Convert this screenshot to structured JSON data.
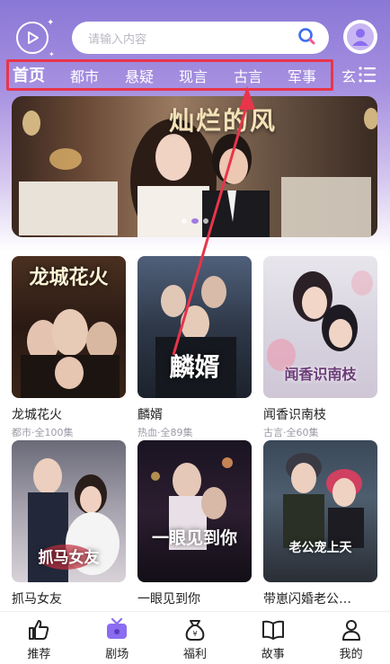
{
  "search": {
    "placeholder": "请输入内容"
  },
  "categories": [
    "首页",
    "都市",
    "悬疑",
    "现言",
    "古言",
    "军事",
    "玄幻"
  ],
  "banner": {
    "title": "灿烂的风"
  },
  "dramas": [
    {
      "name": "龙城花火",
      "meta": "都市·全100集",
      "poster_text": "龙城花火"
    },
    {
      "name": "麟婿",
      "meta": "热血·全89集",
      "poster_text": "麟婿"
    },
    {
      "name": "闻香识南枝",
      "meta": "古言·全60集",
      "poster_text": "闻香识南枝"
    },
    {
      "name": "抓马女友",
      "meta": "",
      "poster_text": "抓马女友"
    },
    {
      "name": "一眼见到你",
      "meta": "",
      "poster_text": "一眼见到你"
    },
    {
      "name": "带崽闪婚老公…",
      "meta": "",
      "poster_text": "老公宠上天"
    }
  ],
  "tabs": [
    {
      "label": "推荐",
      "icon": "thumbs-up-icon"
    },
    {
      "label": "剧场",
      "icon": "tv-icon"
    },
    {
      "label": "福利",
      "icon": "money-bag-icon"
    },
    {
      "label": "故事",
      "icon": "book-icon"
    },
    {
      "label": "我的",
      "icon": "user-icon"
    }
  ],
  "colors": {
    "accent": "#8b6cf0",
    "highlight": "#e8354a",
    "header_top": "#8a78d6"
  }
}
